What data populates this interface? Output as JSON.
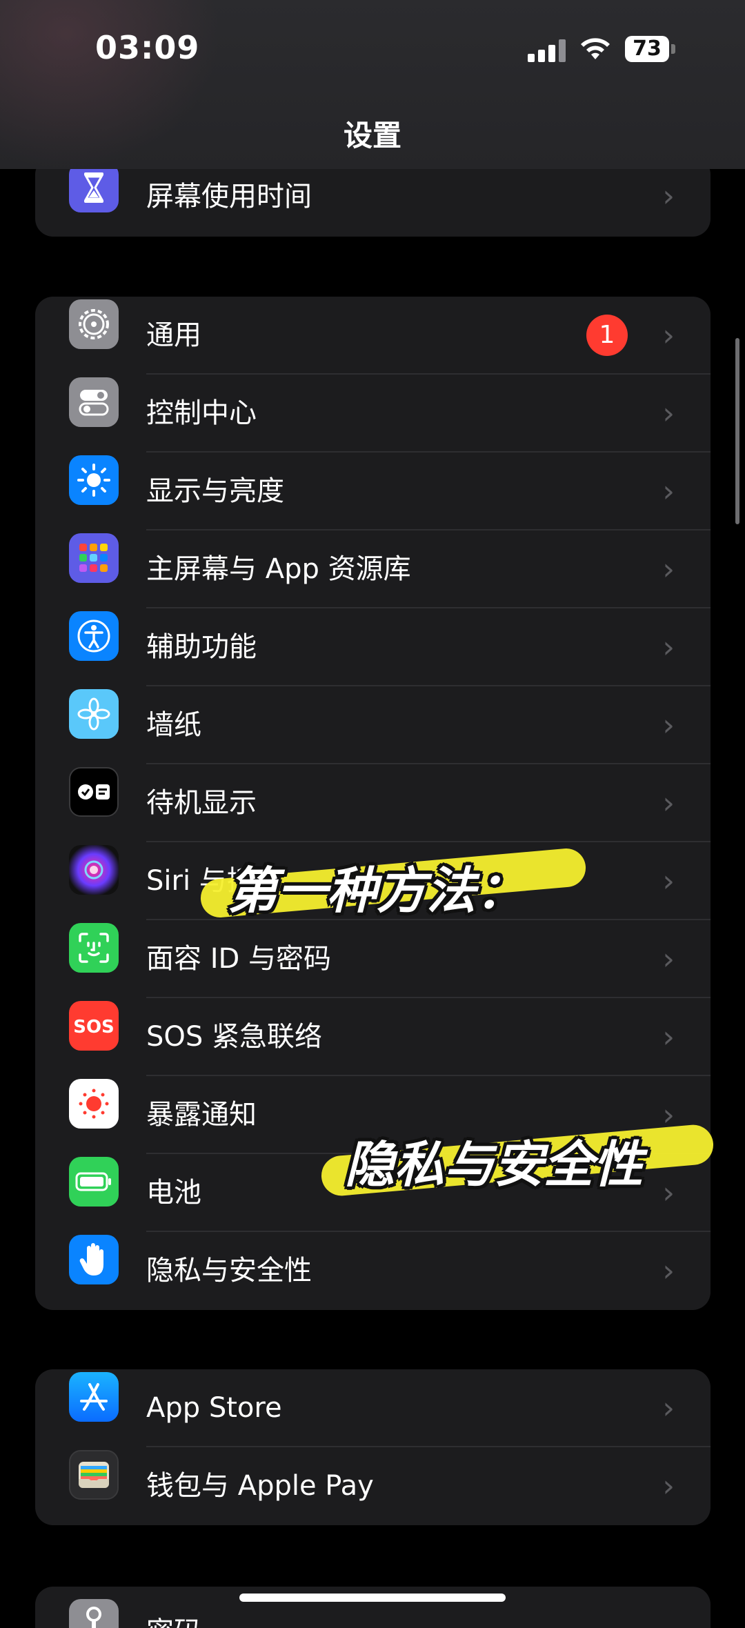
{
  "status_bar": {
    "time": "03:09",
    "battery": "73"
  },
  "nav": {
    "title": "设置"
  },
  "groups": [
    {
      "items": [
        {
          "label": "屏幕使用时间",
          "icon": "hourglass-icon",
          "color": "#5e5ce6"
        }
      ]
    },
    {
      "items": [
        {
          "label": "通用",
          "icon": "gear-icon",
          "color": "#8e8e93",
          "badge": "1"
        },
        {
          "label": "控制中心",
          "icon": "toggle-switches-icon",
          "color": "#8e8e93"
        },
        {
          "label": "显示与亮度",
          "icon": "sun-icon",
          "color": "#0a84ff"
        },
        {
          "label": "主屏幕与 App 资源库",
          "icon": "app-grid-icon",
          "color": "#5e5ce6"
        },
        {
          "label": "辅助功能",
          "icon": "accessibility-icon",
          "color": "#0a84ff"
        },
        {
          "label": "墙纸",
          "icon": "flower-icon",
          "color": "#5ac8fa"
        },
        {
          "label": "待机显示",
          "icon": "standby-icon",
          "color": "#000000"
        },
        {
          "label": "Siri 与搜索",
          "icon": "siri-icon",
          "color": "#2c2c2e"
        },
        {
          "label": "面容 ID 与密码",
          "icon": "face-id-icon",
          "color": "#30d158"
        },
        {
          "label": "SOS 紧急联络",
          "icon": "sos-icon",
          "color": "#ff3b30"
        },
        {
          "label": "暴露通知",
          "icon": "exposure-icon",
          "color": "#ffffff"
        },
        {
          "label": "电池",
          "icon": "battery-icon",
          "color": "#30d158"
        },
        {
          "label": "隐私与安全性",
          "icon": "hand-icon",
          "color": "#0a84ff"
        }
      ]
    },
    {
      "items": [
        {
          "label": "App Store",
          "icon": "app-store-icon",
          "color": "#0a84ff"
        },
        {
          "label": "钱包与 Apple Pay",
          "icon": "wallet-icon",
          "color": "#2c2c2e"
        }
      ]
    },
    {
      "items": [
        {
          "label": "密码",
          "icon": "key-icon",
          "color": "#8e8e93"
        }
      ]
    }
  ],
  "overlay": {
    "text1": "第一种方法：",
    "text2": "隐私与安全性",
    "highlight_color": "#f5ef2e"
  }
}
